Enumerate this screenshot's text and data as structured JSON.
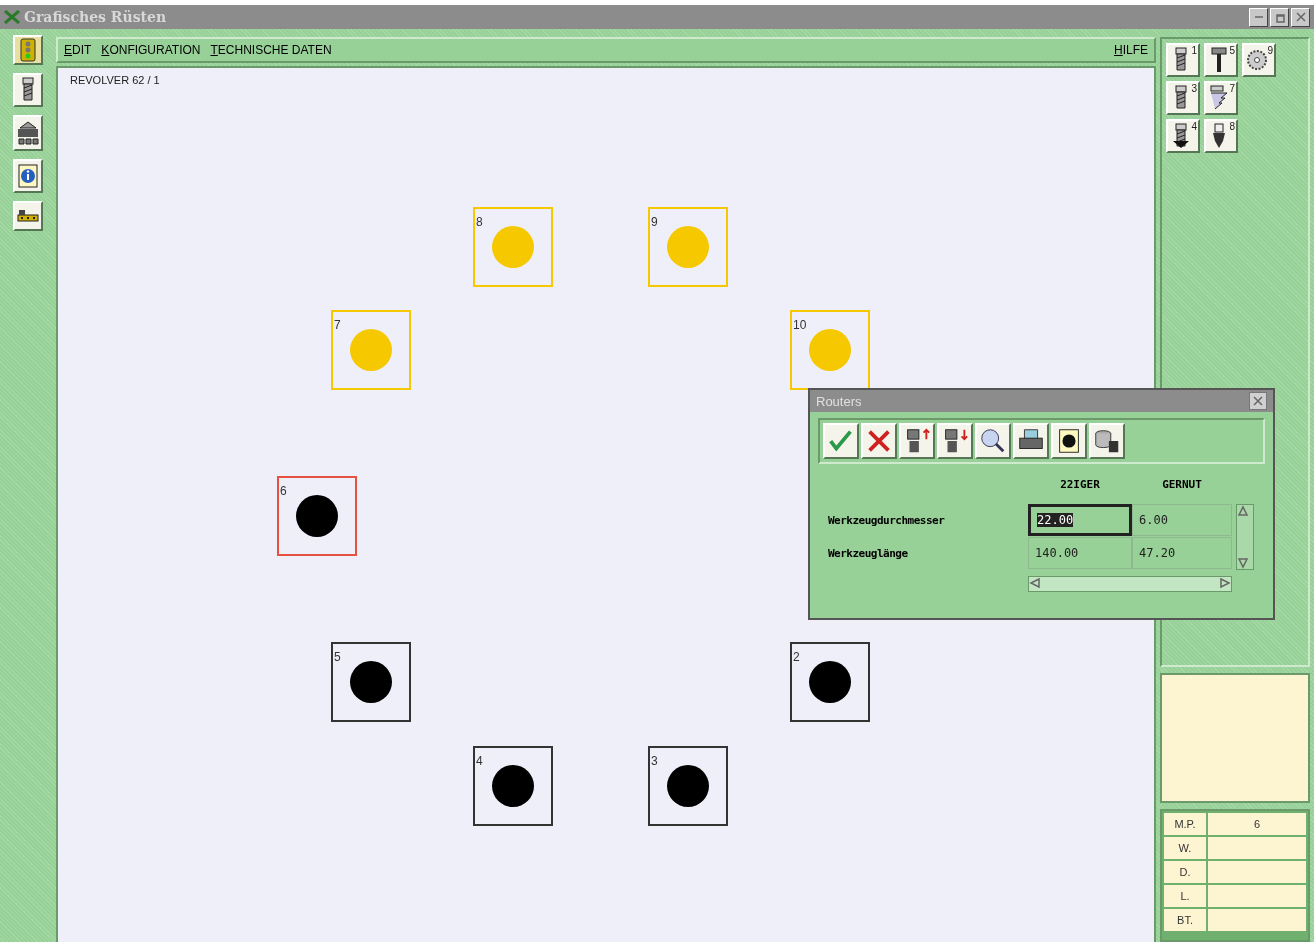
{
  "window": {
    "title": "Grafisches Rüsten"
  },
  "menu": {
    "items": [
      {
        "label": "EDIT"
      },
      {
        "label": "KONFIGURATION"
      },
      {
        "label": "TECHNISCHE DATEN"
      }
    ],
    "help": "HILFE"
  },
  "canvas": {
    "title": "REVOLVER 62 / 1",
    "pockets": [
      {
        "label": "8",
        "color": "#f5c800",
        "selected": false
      },
      {
        "label": "9",
        "color": "#f5c800",
        "selected": false
      },
      {
        "label": "7",
        "color": "#f5c800",
        "selected": false
      },
      {
        "label": "10",
        "color": "#f5c800",
        "selected": false
      },
      {
        "label": "6",
        "color": "#000000",
        "selected": true
      },
      {
        "label": "5",
        "color": "#000000",
        "selected": false
      },
      {
        "label": "2",
        "color": "#000000",
        "selected": false
      },
      {
        "label": "4",
        "color": "#000000",
        "selected": false
      },
      {
        "label": "3",
        "color": "#000000",
        "selected": false
      }
    ]
  },
  "tools": [
    {
      "number": "1"
    },
    {
      "number": "5"
    },
    {
      "number": "9"
    },
    {
      "number": "3"
    },
    {
      "number": "7"
    },
    {
      "number": "4"
    },
    {
      "number": "8"
    }
  ],
  "dialog": {
    "title": "Routers",
    "columns": [
      "22IGER",
      "GERNUT"
    ],
    "rows": [
      {
        "label": "Werkzeugdurchmesser",
        "cells": [
          {
            "value": "22.00",
            "selected": true
          },
          {
            "value": "6.00",
            "selected": false
          }
        ]
      },
      {
        "label": "Werkzeuglänge",
        "cells": [
          {
            "value": "140.00",
            "selected": false
          },
          {
            "value": "47.20",
            "selected": false
          }
        ]
      }
    ]
  },
  "info_table": [
    {
      "label": "M.P.",
      "value": "6"
    },
    {
      "label": "W."
    },
    {
      "label": "D."
    },
    {
      "label": "L."
    },
    {
      "label": "BT."
    }
  ]
}
